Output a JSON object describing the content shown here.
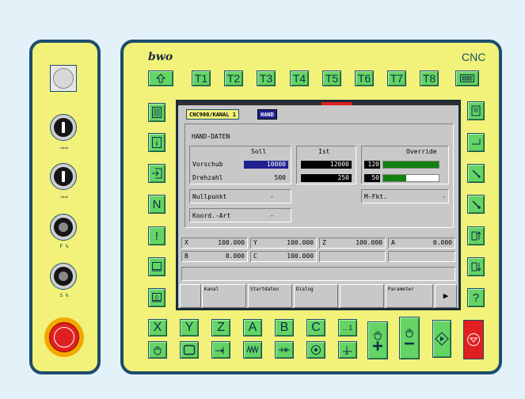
{
  "brand": "bwo",
  "cnc_label": "CNC",
  "left_panel": {
    "knob1_label": "⇒⇒",
    "knob2_label": "⇒⇒",
    "feed_label": "F %",
    "spindle_label": "S %"
  },
  "top_keys": [
    "T1",
    "T2",
    "T3",
    "T4",
    "T5",
    "T6",
    "T7",
    "T8"
  ],
  "screen": {
    "channel": "CNC900/KANAL 1",
    "mode": "HAND",
    "title": "HAND-DATEN",
    "soll_header": "Soll",
    "ist_header": "Ist",
    "override_header": "Override",
    "rows": [
      {
        "label": "Vorschub",
        "soll": "10000",
        "ist": "12000"
      },
      {
        "label": "Drehzahl",
        "soll": "500",
        "ist": "250"
      }
    ],
    "overrides": [
      {
        "value": "120",
        "percent": 100
      },
      {
        "value": "50",
        "percent": 42
      }
    ],
    "nullpunkt": {
      "label": "Nullpunkt",
      "value": "-"
    },
    "koord": {
      "label": "Koord.-Art",
      "value": "-"
    },
    "mfkt": {
      "label": "M-Fkt.",
      "value": "-"
    },
    "axes": [
      {
        "axis": "X",
        "value": "100.000"
      },
      {
        "axis": "Y",
        "value": "100.000"
      },
      {
        "axis": "Z",
        "value": "100.000"
      },
      {
        "axis": "A",
        "value": "0.000"
      },
      {
        "axis": "B",
        "value": "0.000"
      },
      {
        "axis": "C",
        "value": "100.000"
      }
    ],
    "softkeys": [
      "",
      "Kanal",
      "Startdaten",
      "Dialog",
      "",
      "Parameter"
    ],
    "softkey_more": "▶"
  },
  "left_keys": [
    "N",
    "!"
  ],
  "right_keys": [
    "?"
  ],
  "axis_keys": [
    "X",
    "Y",
    "Z",
    "A",
    "B",
    "C"
  ],
  "bottom_small_key": "...1",
  "colors": {
    "panel": "#f2f27a",
    "border": "#1c4d6b",
    "key": "#64d464",
    "stop": "#e02020",
    "screen_bg": "#c8c8c8",
    "highlight": "#202090"
  }
}
